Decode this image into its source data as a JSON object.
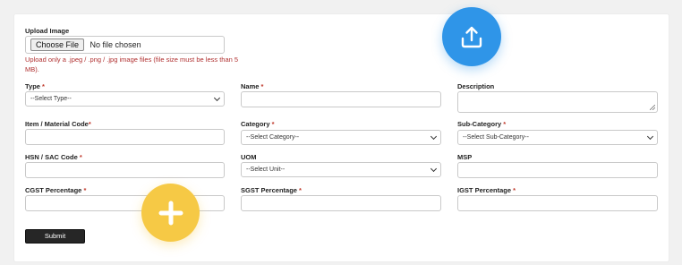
{
  "upload": {
    "label": "Upload Image",
    "choose_button": "Choose File",
    "file_status": "No file chosen",
    "hint": "Upload only a .jpeg / .png / .jpg image files (file size must be less than 5 MB)."
  },
  "fields": {
    "type": {
      "label": "Type",
      "required": "*",
      "selected": "--Select Type--"
    },
    "name": {
      "label": "Name",
      "required": "*",
      "value": ""
    },
    "description": {
      "label": "Description",
      "value": ""
    },
    "item_code": {
      "label": "Item / Material Code",
      "required": "*",
      "value": ""
    },
    "category": {
      "label": "Category",
      "required": "*",
      "selected": "--Select Category--"
    },
    "sub_category": {
      "label": "Sub-Category",
      "required": "*",
      "selected": "--Select Sub-Category--"
    },
    "hsn_sac": {
      "label": "HSN / SAC Code",
      "required": "*",
      "value": ""
    },
    "uom": {
      "label": "UOM",
      "selected": "--Select Unit--"
    },
    "msp": {
      "label": "MSP",
      "value": ""
    },
    "cgst": {
      "label": "CGST Percentage",
      "required": "*",
      "value": ""
    },
    "sgst": {
      "label": "SGST Percentage",
      "required": "*",
      "value": ""
    },
    "igst": {
      "label": "IGST Percentage",
      "required": "*",
      "value": ""
    }
  },
  "submit_label": "Submit",
  "icons": {
    "upload": "upload-icon",
    "plus": "plus-icon"
  },
  "colors": {
    "upload_circle": "#2f95e8",
    "plus_circle": "#f6c945",
    "required": "#c0392b",
    "hint": "#b03030",
    "submit_bg": "#262626"
  }
}
